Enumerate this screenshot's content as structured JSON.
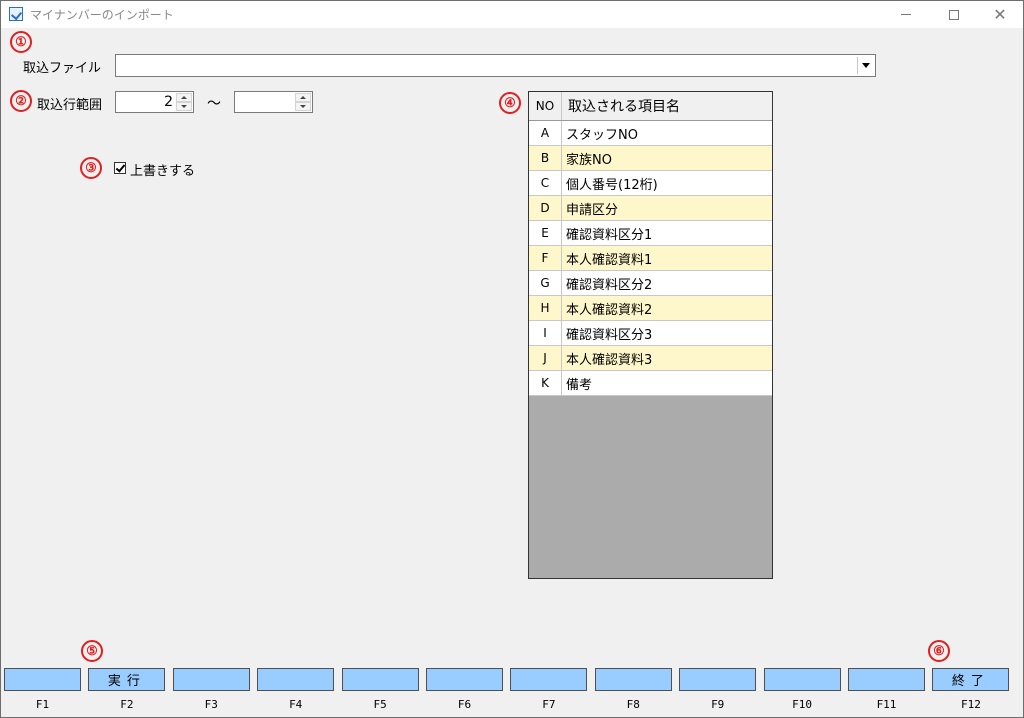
{
  "window": {
    "title": "マイナンバーのインポート",
    "minimize_glyph": "minimize-icon",
    "maximize_glyph": "maximize-icon",
    "close_glyph": "✕"
  },
  "markers": [
    "①",
    "②",
    "③",
    "④",
    "⑤",
    "⑥"
  ],
  "import_file": {
    "label": "取込ファイル",
    "value": ""
  },
  "row_range": {
    "label": "取込行範囲",
    "from": "2",
    "separator": "〜",
    "to": ""
  },
  "overwrite": {
    "label": "上書きする",
    "checked": true
  },
  "grid": {
    "headers": [
      "NO",
      "取込される項目名"
    ],
    "rows": [
      {
        "no": "A",
        "name": "スタッフNO"
      },
      {
        "no": "B",
        "name": "家族NO"
      },
      {
        "no": "C",
        "name": "個人番号(12桁)"
      },
      {
        "no": "D",
        "name": "申請区分"
      },
      {
        "no": "E",
        "name": "確認資料区分1"
      },
      {
        "no": "F",
        "name": "本人確認資料1"
      },
      {
        "no": "G",
        "name": "確認資料区分2"
      },
      {
        "no": "H",
        "name": "本人確認資料2"
      },
      {
        "no": "I",
        "name": "確認資料区分3"
      },
      {
        "no": "J",
        "name": "本人確認資料3"
      },
      {
        "no": "K",
        "name": "備考"
      }
    ],
    "row_colors": {
      "odd": "#ffffff",
      "even": "#fff7cc"
    }
  },
  "function_keys": [
    {
      "key": "F1",
      "label": ""
    },
    {
      "key": "F2",
      "label": "実行"
    },
    {
      "key": "F3",
      "label": ""
    },
    {
      "key": "F4",
      "label": ""
    },
    {
      "key": "F5",
      "label": ""
    },
    {
      "key": "F6",
      "label": ""
    },
    {
      "key": "F7",
      "label": ""
    },
    {
      "key": "F8",
      "label": ""
    },
    {
      "key": "F9",
      "label": ""
    },
    {
      "key": "F10",
      "label": ""
    },
    {
      "key": "F11",
      "label": ""
    },
    {
      "key": "F12",
      "label": "終了"
    }
  ],
  "colors": {
    "fkey_fill": "#99ccff",
    "marker": "#e02020",
    "grid_empty": "#ababab"
  }
}
